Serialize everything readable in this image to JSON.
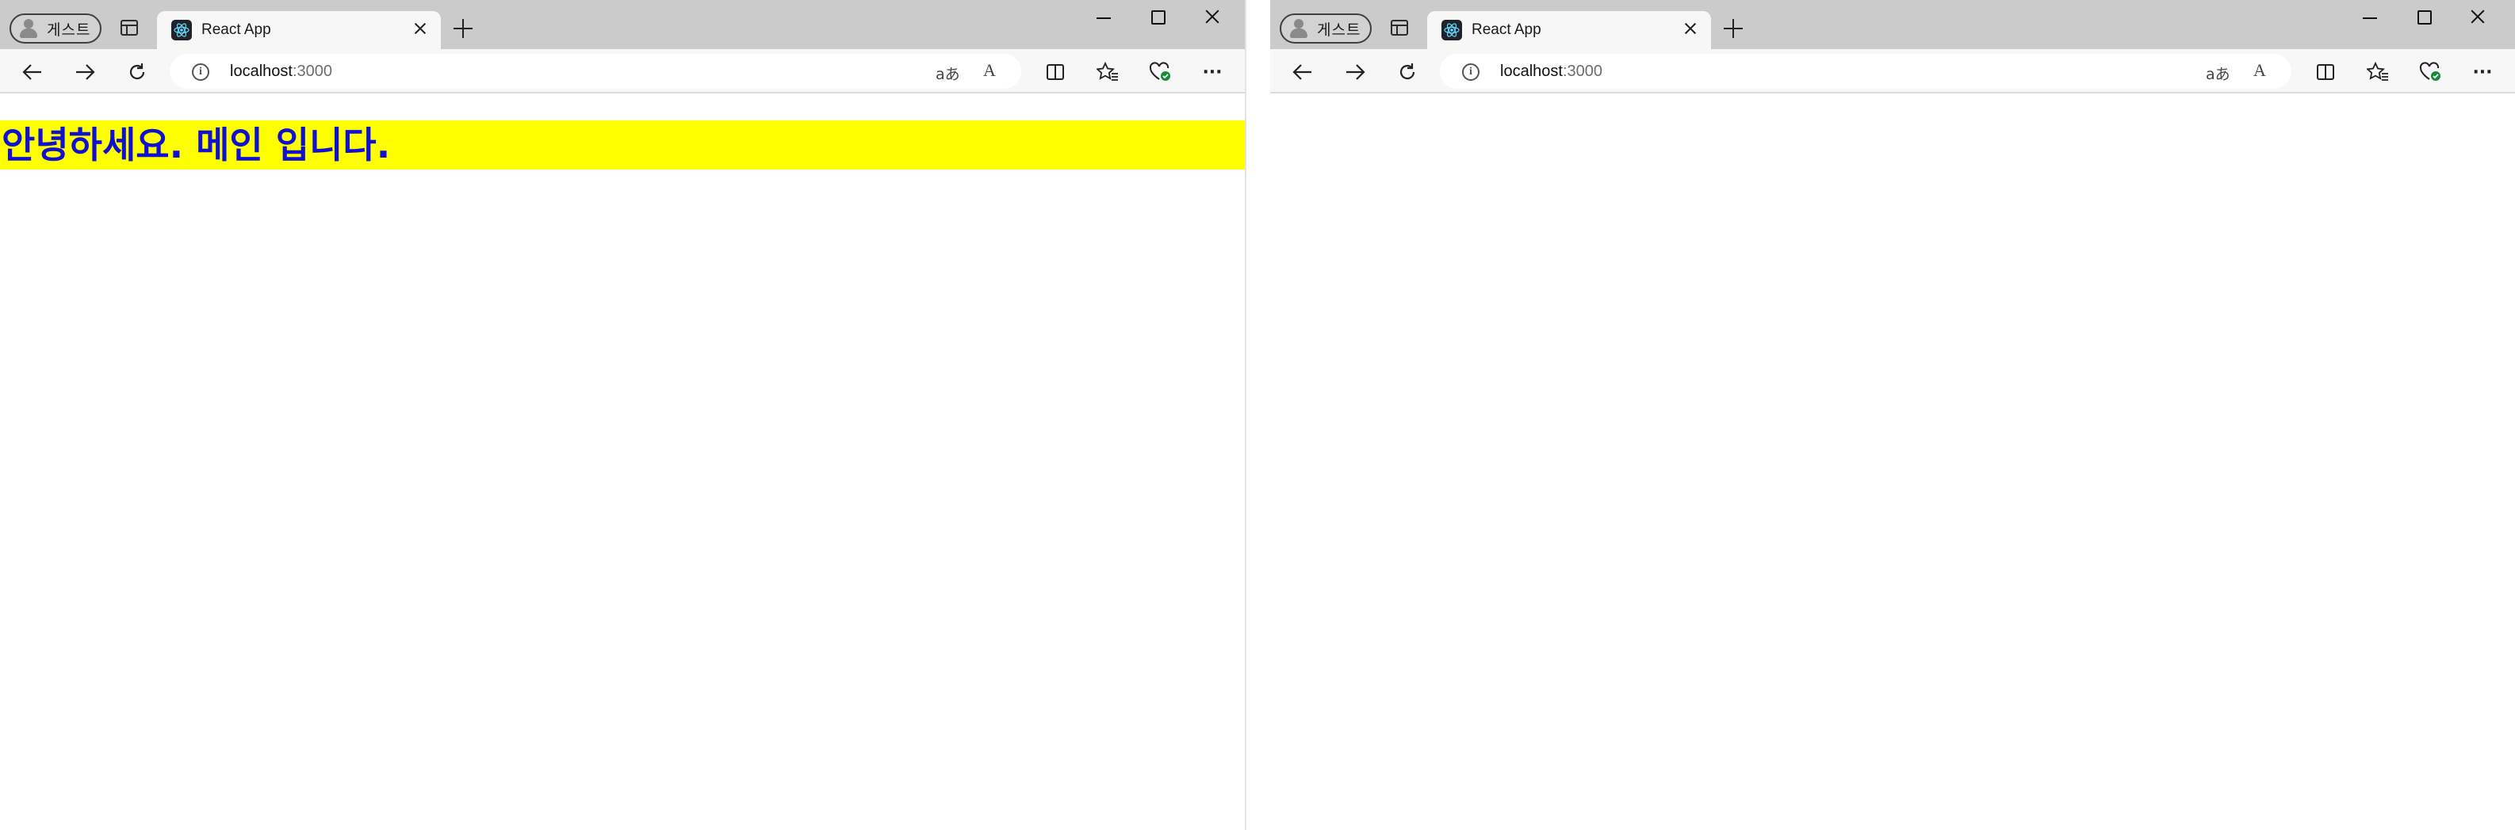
{
  "windows": [
    {
      "profile_label": "게스트",
      "tab_title": "React App",
      "url_host": "localhost",
      "url_port": ":3000",
      "page": {
        "heading": "안녕하세요. 메인 입니다.",
        "heading_bg": "#ffff00",
        "heading_color": "#1010d0"
      }
    },
    {
      "profile_label": "게스트",
      "tab_title": "React App",
      "url_host": "localhost",
      "url_port": ":3000"
    }
  ],
  "icons": {
    "translate": "aあ",
    "read_aloud": "A",
    "more": "···"
  },
  "colors": {
    "titlebar": "#cbcbcb",
    "toolbar": "#f7f7f7",
    "page": "#ffffff"
  }
}
